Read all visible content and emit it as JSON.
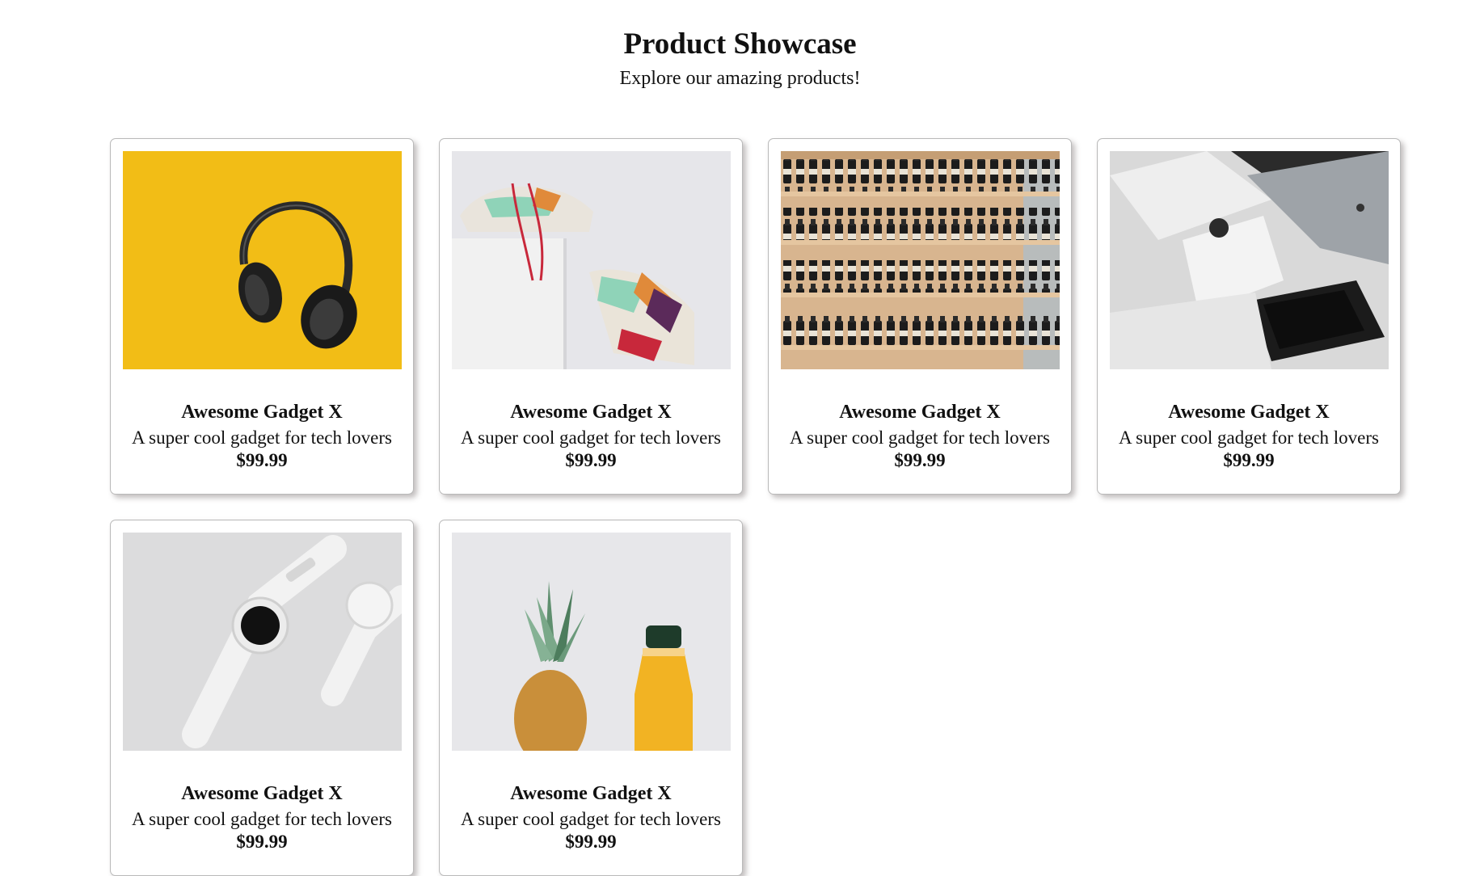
{
  "header": {
    "title": "Product Showcase",
    "subtitle": "Explore our amazing products!"
  },
  "products": [
    {
      "name": "Awesome Gadget X",
      "description": "A super cool gadget for tech lovers",
      "price": "$99.99",
      "image": "headphones-photo"
    },
    {
      "name": "Awesome Gadget X",
      "description": "A super cool gadget for tech lovers",
      "price": "$99.99",
      "image": "sneakers-photo"
    },
    {
      "name": "Awesome Gadget X",
      "description": "A super cool gadget for tech lovers",
      "price": "$99.99",
      "image": "bottle-shelves-photo"
    },
    {
      "name": "Awesome Gadget X",
      "description": "A super cool gadget for tech lovers",
      "price": "$99.99",
      "image": "apple-devices-photo"
    },
    {
      "name": "Awesome Gadget X",
      "description": "A super cool gadget for tech lovers",
      "price": "$99.99",
      "image": "smartwatch-photo"
    },
    {
      "name": "Awesome Gadget X",
      "description": "A super cool gadget for tech lovers",
      "price": "$99.99",
      "image": "pineapple-juice-photo"
    }
  ],
  "colors": {
    "headphones_bg": "#f6c51a",
    "card_border": "#b9b9b9",
    "text": "#111111"
  }
}
